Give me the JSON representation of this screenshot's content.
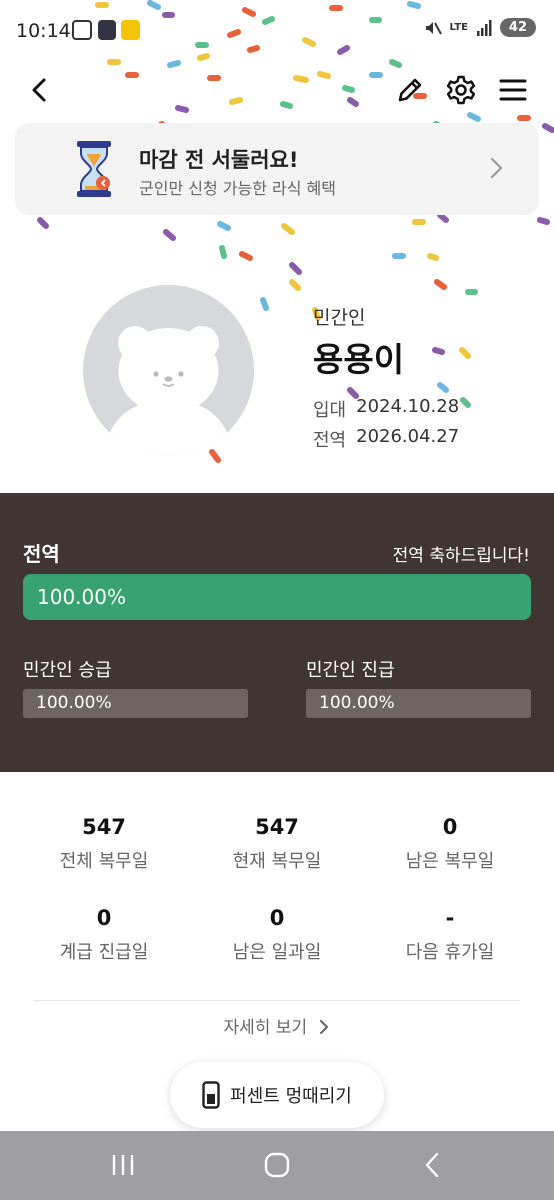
{
  "status_bar": {
    "time": "10:14",
    "network": "LTE",
    "battery": "42"
  },
  "top_bar": {
    "icons": [
      "back-icon",
      "edit-icon",
      "gear-icon",
      "menu-icon"
    ]
  },
  "banner": {
    "title": "마감 전 서둘러요!",
    "subtitle": "군인만 신청 가능한 라식 혜택",
    "icon": "hourglass-icon"
  },
  "profile": {
    "role": "민간인",
    "name": "용용이",
    "enlist_label": "입대",
    "enlist_date": "2024.10.28",
    "discharge_label": "전역",
    "discharge_date": "2026.04.27"
  },
  "progress": {
    "title": "전역",
    "message": "전역 축하드립니다!",
    "main_percent_text": "100.00%",
    "main_fraction": 1.0,
    "promotion_label": "민간인 승급",
    "promotion_percent_text": "100.00%",
    "promotion_fraction": 1.0,
    "rank_label": "민간인 진급",
    "rank_percent_text": "100.00%",
    "rank_fraction": 1.0
  },
  "stats": [
    {
      "value": "547",
      "label": "전체 복무일"
    },
    {
      "value": "547",
      "label": "현재 복무일"
    },
    {
      "value": "0",
      "label": "남은 복무일"
    },
    {
      "value": "0",
      "label": "계급 진급일"
    },
    {
      "value": "0",
      "label": "남은 일과일"
    },
    {
      "value": "-",
      "label": "다음 휴가일"
    }
  ],
  "details_link": "자세히 보기",
  "fab": {
    "label": "퍼센트 멍때리기"
  },
  "colors": {
    "panel_bg": "#403533",
    "progress_green": "#38a270",
    "sub_bar": "#6e6462"
  }
}
